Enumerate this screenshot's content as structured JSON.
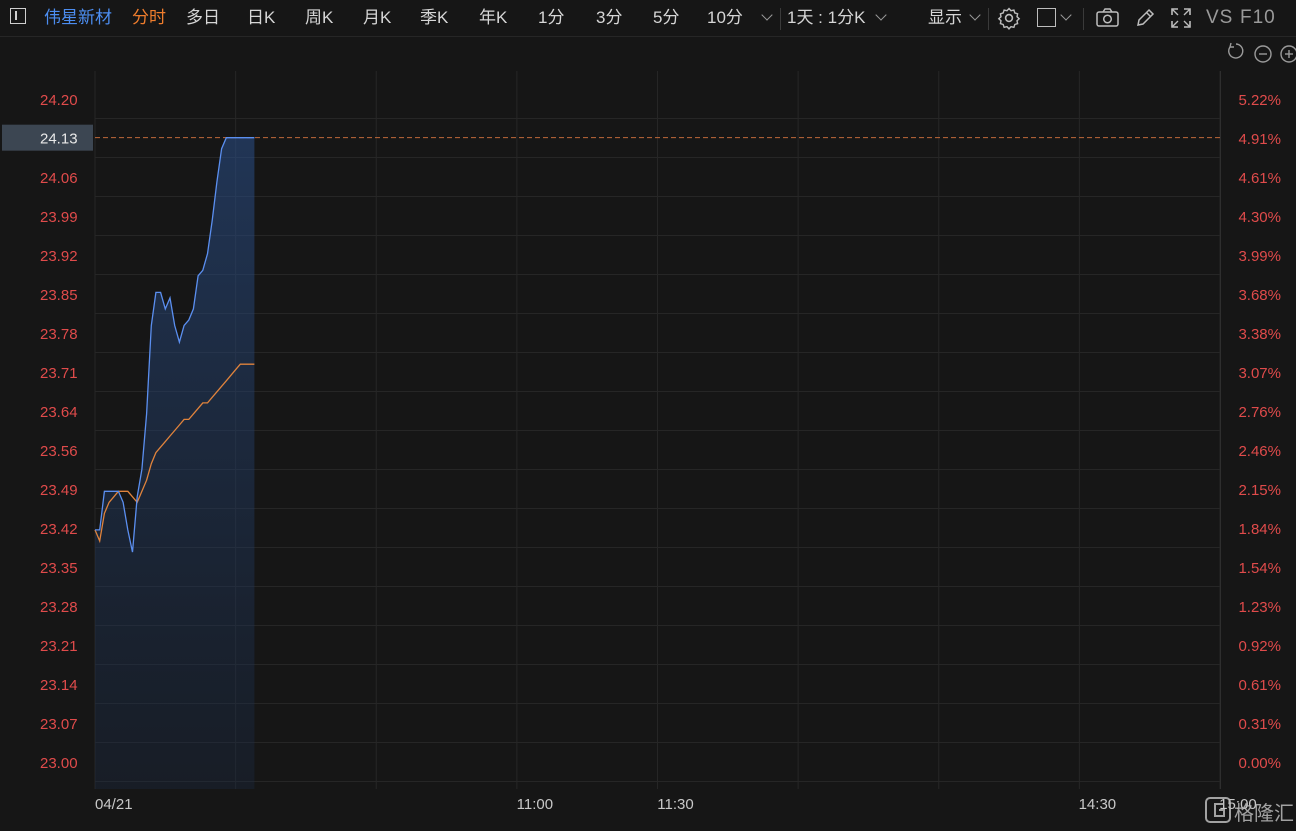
{
  "toolbar": {
    "stock_name": "伟星新材",
    "tabs": [
      "分时",
      "多日",
      "日K",
      "周K",
      "月K",
      "季K",
      "年K",
      "1分",
      "3分",
      "5分",
      "10分"
    ],
    "active_tab": "分时",
    "sync_label": "1天 : 1分K",
    "display_label": "显示",
    "vs_label": "VS",
    "f10_label": "F10"
  },
  "colors": {
    "background": "#161616",
    "grid": "#262626",
    "axis_text_left": "#e04b4b",
    "axis_text_right": "#e04b4b",
    "price_line": "#5b8ff0",
    "avg_line": "#e0833c",
    "ref_line": "#c0693a",
    "accent_tab": "#ef7d2d",
    "stock_name": "#4c8df0"
  },
  "chart_data": {
    "type": "line",
    "title": "",
    "xlabel": "",
    "ylabel": "",
    "x_tick_labels": [
      "04/21",
      "11:00",
      "11:30",
      "14:30",
      "15:00"
    ],
    "x_tick_times": [
      "09:30",
      "11:00",
      "11:30",
      "14:30",
      "15:00"
    ],
    "y_left_ticks": [
      "23.00",
      "23.07",
      "23.14",
      "23.21",
      "23.28",
      "23.35",
      "23.42",
      "23.49",
      "23.56",
      "23.64",
      "23.71",
      "23.78",
      "23.85",
      "23.92",
      "23.99",
      "24.06",
      "24.13",
      "24.20"
    ],
    "y_right_ticks": [
      "0.00%",
      "0.31%",
      "0.61%",
      "0.92%",
      "1.23%",
      "1.54%",
      "1.84%",
      "2.15%",
      "2.46%",
      "2.76%",
      "3.07%",
      "3.38%",
      "3.68%",
      "3.99%",
      "4.30%",
      "4.61%",
      "4.91%",
      "5.22%"
    ],
    "ylim": [
      23.0,
      24.2
    ],
    "current_price": "24.13",
    "current_pct": "4.91%",
    "grid": true,
    "series": [
      {
        "time": [
          "09:30",
          "09:31",
          "09:32",
          "09:33",
          "09:34",
          "09:35",
          "09:36",
          "09:37",
          "09:38",
          "09:39",
          "09:40",
          "09:41",
          "09:42",
          "09:43",
          "09:44",
          "09:45",
          "09:46",
          "09:47",
          "09:48",
          "09:49",
          "09:50",
          "09:51",
          "09:52",
          "09:53",
          "09:54",
          "09:55",
          "09:56",
          "09:57",
          "09:58",
          "09:59",
          "10:00",
          "10:01",
          "10:02",
          "10:03",
          "10:04"
        ],
        "values": [
          23.42,
          23.42,
          23.49,
          23.49,
          23.49,
          23.49,
          23.47,
          23.42,
          23.38,
          23.48,
          23.53,
          23.63,
          23.79,
          23.85,
          23.85,
          23.82,
          23.84,
          23.79,
          23.76,
          23.79,
          23.8,
          23.82,
          23.88,
          23.89,
          23.92,
          23.98,
          24.05,
          24.11,
          24.13,
          24.13,
          24.13,
          24.13,
          24.13,
          24.13,
          24.13
        ]
      },
      {
        "time": [
          "09:30",
          "09:31",
          "09:32",
          "09:33",
          "09:34",
          "09:35",
          "09:36",
          "09:37",
          "09:38",
          "09:39",
          "09:40",
          "09:41",
          "09:42",
          "09:43",
          "09:44",
          "09:45",
          "09:46",
          "09:47",
          "09:48",
          "09:49",
          "09:50",
          "09:51",
          "09:52",
          "09:53",
          "09:54",
          "09:55",
          "09:56",
          "09:57",
          "09:58",
          "09:59",
          "10:00",
          "10:01",
          "10:02",
          "10:03",
          "10:04"
        ],
        "values": [
          23.42,
          23.4,
          23.45,
          23.47,
          23.48,
          23.49,
          23.49,
          23.49,
          23.48,
          23.47,
          23.49,
          23.51,
          23.54,
          23.56,
          23.57,
          23.58,
          23.59,
          23.6,
          23.61,
          23.62,
          23.62,
          23.63,
          23.64,
          23.65,
          23.65,
          23.66,
          23.67,
          23.68,
          23.69,
          23.7,
          23.71,
          23.72,
          23.72,
          23.72,
          23.72
        ]
      }
    ]
  },
  "watermark": "格隆汇"
}
